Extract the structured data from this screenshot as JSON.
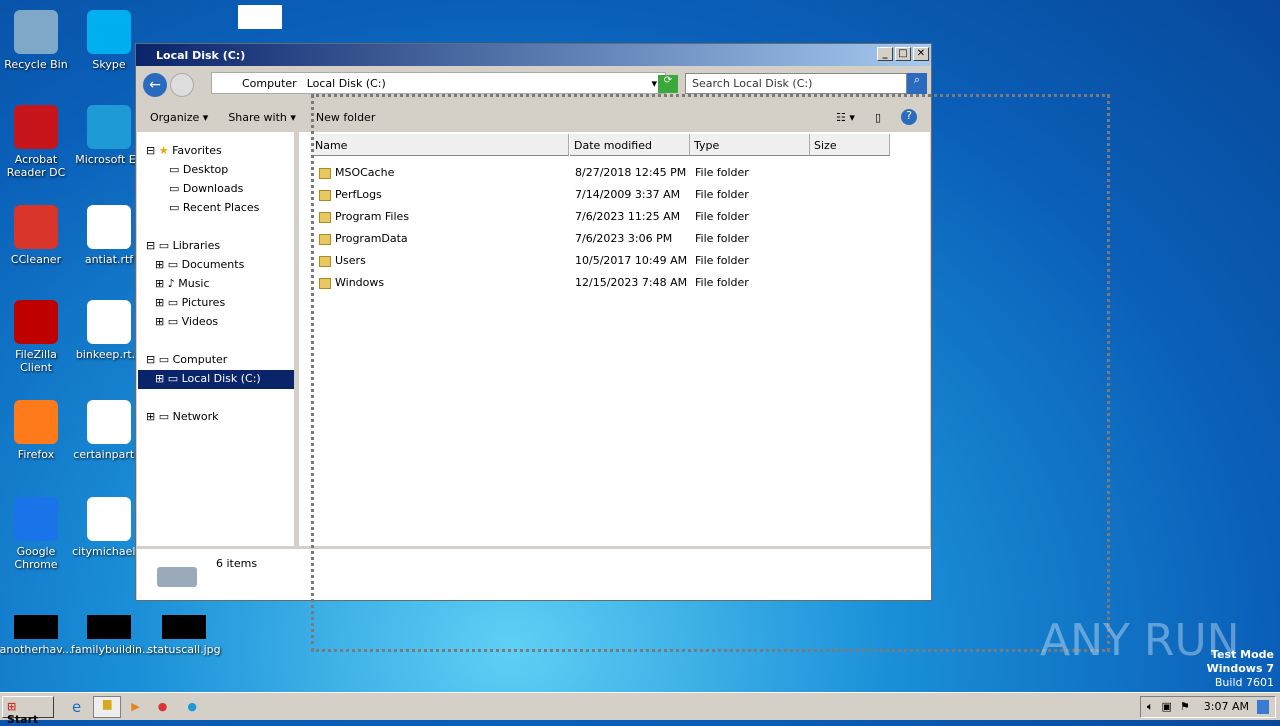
{
  "desktop": {
    "icons": [
      {
        "label": "Recycle Bin",
        "color": "#7fa8c8"
      },
      {
        "label": "Acrobat Reader DC",
        "color": "#c8151b"
      },
      {
        "label": "CCleaner",
        "color": "#d8342a"
      },
      {
        "label": "FileZilla Client",
        "color": "#bf0000"
      },
      {
        "label": "Firefox",
        "color": "#ff7a1a"
      },
      {
        "label": "Google Chrome",
        "color": "#1a73e8"
      },
      {
        "label": "anotherhav...",
        "color": "#000000"
      },
      {
        "label": "Skype",
        "color": "#00aff0"
      },
      {
        "label": "Microsoft Ed",
        "color": "#1e9bd7"
      },
      {
        "label": "antiat.rtf",
        "color": "#ffffff"
      },
      {
        "label": "binkeep.rt...",
        "color": "#ffffff"
      },
      {
        "label": "certainpart...",
        "color": "#ffffff"
      },
      {
        "label": "citymichael...",
        "color": "#ffffff"
      },
      {
        "label": "familybuildin...",
        "color": "#000000"
      },
      {
        "label": "",
        "color": "#ffffff"
      },
      {
        "label": "statuscall.jpg",
        "color": "#000000"
      }
    ],
    "watermark": "ANY RUN",
    "test_mode": "Test Mode",
    "os": "Windows 7",
    "build": "Build 7601"
  },
  "window": {
    "title": "Local Disk (C:)",
    "breadcrumb": [
      "Computer",
      "Local Disk (C:)"
    ],
    "search_placeholder": "Search Local Disk (C:)",
    "toolbar": {
      "organize": "Organize",
      "share": "Share with",
      "new_folder": "New folder"
    },
    "nav": {
      "favorites": "Favorites",
      "desktop": "Desktop",
      "downloads": "Downloads",
      "recent": "Recent Places",
      "libraries": "Libraries",
      "documents": "Documents",
      "music": "Music",
      "pictures": "Pictures",
      "videos": "Videos",
      "computer": "Computer",
      "local_disk": "Local Disk (C:)",
      "network": "Network"
    },
    "columns": [
      "Name",
      "Date modified",
      "Type",
      "Size"
    ],
    "files": [
      {
        "name": "MSOCache",
        "date": "8/27/2018 12:45 PM",
        "type": "File folder"
      },
      {
        "name": "PerfLogs",
        "date": "7/14/2009 3:37 AM",
        "type": "File folder"
      },
      {
        "name": "Program Files",
        "date": "7/6/2023 11:25 AM",
        "type": "File folder"
      },
      {
        "name": "ProgramData",
        "date": "7/6/2023 3:06 PM",
        "type": "File folder"
      },
      {
        "name": "Users",
        "date": "10/5/2017 10:49 AM",
        "type": "File folder"
      },
      {
        "name": "Windows",
        "date": "12/15/2023 7:48 AM",
        "type": "File folder"
      }
    ],
    "status": "6 items"
  },
  "taskbar": {
    "start": "Start",
    "clock": "3:07 AM"
  }
}
